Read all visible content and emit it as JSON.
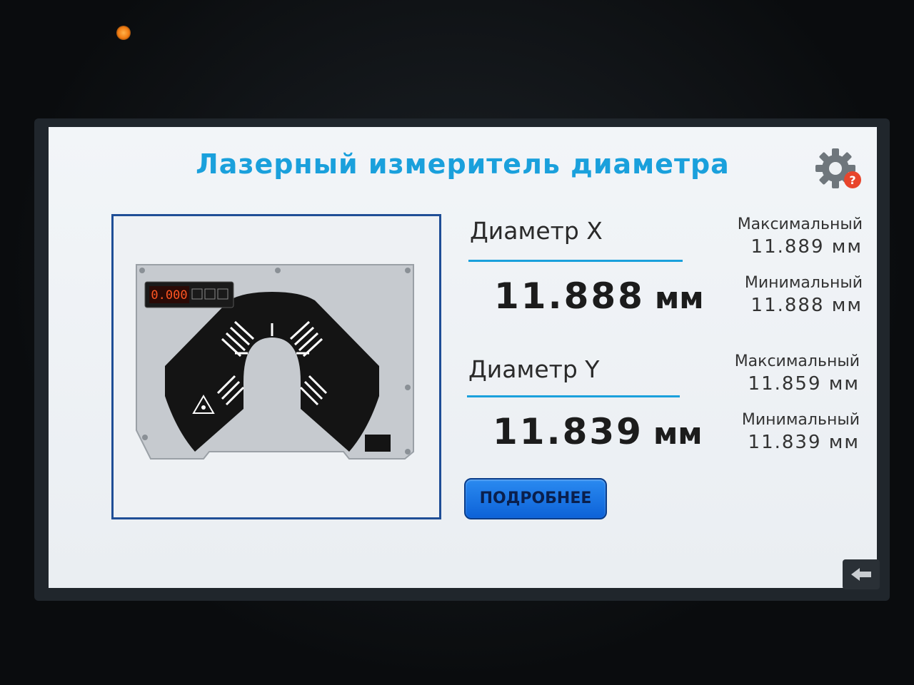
{
  "header": {
    "title": "Лазерный измеритель диаметра"
  },
  "device": {
    "display_reading": "0.000"
  },
  "diameter_x": {
    "label": "Диаметр X",
    "value": "11.888",
    "unit": "мм",
    "max_label": "Максимальный",
    "max_value": "11.889  мм",
    "min_label": "Минимальный",
    "min_value": "11.888  мм"
  },
  "diameter_y": {
    "label": "Диаметр Y",
    "value": "11.839",
    "unit": "мм",
    "max_label": "Максимальный",
    "max_value": "11.859  мм",
    "min_label": "Минимальный",
    "min_value": "11.839  мм"
  },
  "actions": {
    "details_label": "ПОДРОБНЕЕ"
  },
  "colors": {
    "accent": "#1aa0dc",
    "button": "#1a78e8",
    "frame": "#1f4e96",
    "alert": "#e8452c"
  },
  "icons": {
    "settings": "gear-question-icon",
    "back": "back-arrow-icon"
  }
}
